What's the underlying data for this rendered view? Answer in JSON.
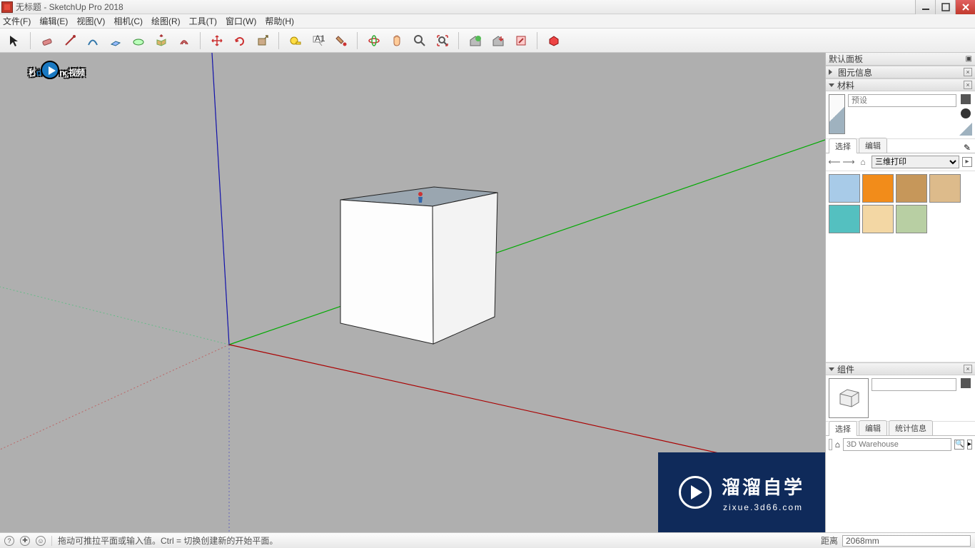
{
  "window": {
    "title": "无标题 - SketchUp Pro 2018"
  },
  "menu": [
    "文件(F)",
    "编辑(E)",
    "视图(V)",
    "相机(C)",
    "绘图(R)",
    "工具(T)",
    "窗口(W)",
    "帮助(H)"
  ],
  "toolbar_icons": [
    "select",
    "eraser",
    "line",
    "arc",
    "rect",
    "circle",
    "pushpull",
    "offset",
    "move",
    "rotate",
    "scale",
    "tape",
    "text",
    "dim",
    "paint",
    "orbit",
    "pan",
    "zoom",
    "zoom-extents",
    "3dw-get",
    "3dw-send",
    "layout",
    "extensions"
  ],
  "tray": {
    "title": "默认面板",
    "entity_info": "图元信息",
    "materials": {
      "title": "材料",
      "name_placeholder": "预设",
      "tabs": {
        "select": "选择",
        "edit": "编辑"
      },
      "library": "三维打印",
      "swatches": [
        "#a8cbe8",
        "#f28c1a",
        "#c6975a",
        "#ddbb8b",
        "#54c0c0",
        "#f3d7a4",
        "#b8cfa3"
      ]
    },
    "components": {
      "title": "组件",
      "tabs": {
        "select": "选择",
        "edit": "编辑",
        "stats": "统计信息"
      },
      "search_placeholder": "3D Warehouse"
    }
  },
  "status": {
    "hint": "拖动可推拉平面或输入值。Ctrl = 切换创建新的开始平面。",
    "measure_label": "距离",
    "measure_value": "2068mm"
  },
  "watermark": {
    "text_parts": [
      "秒",
      "d",
      "ng",
      "视频"
    ]
  },
  "brand": {
    "big": "溜溜自学",
    "small": "zixue.3d66.com"
  }
}
